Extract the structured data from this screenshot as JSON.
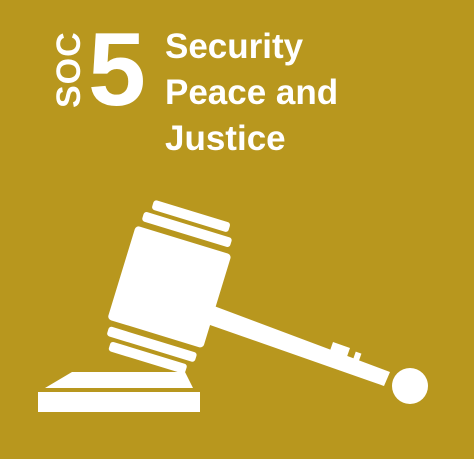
{
  "tile": {
    "code": "SOC",
    "number": "5",
    "title_lines": [
      "Security",
      "Peace and",
      "Justice"
    ],
    "background_color": "#B8971E",
    "foreground_color": "#FFFFFF",
    "icon": "gavel-icon"
  }
}
